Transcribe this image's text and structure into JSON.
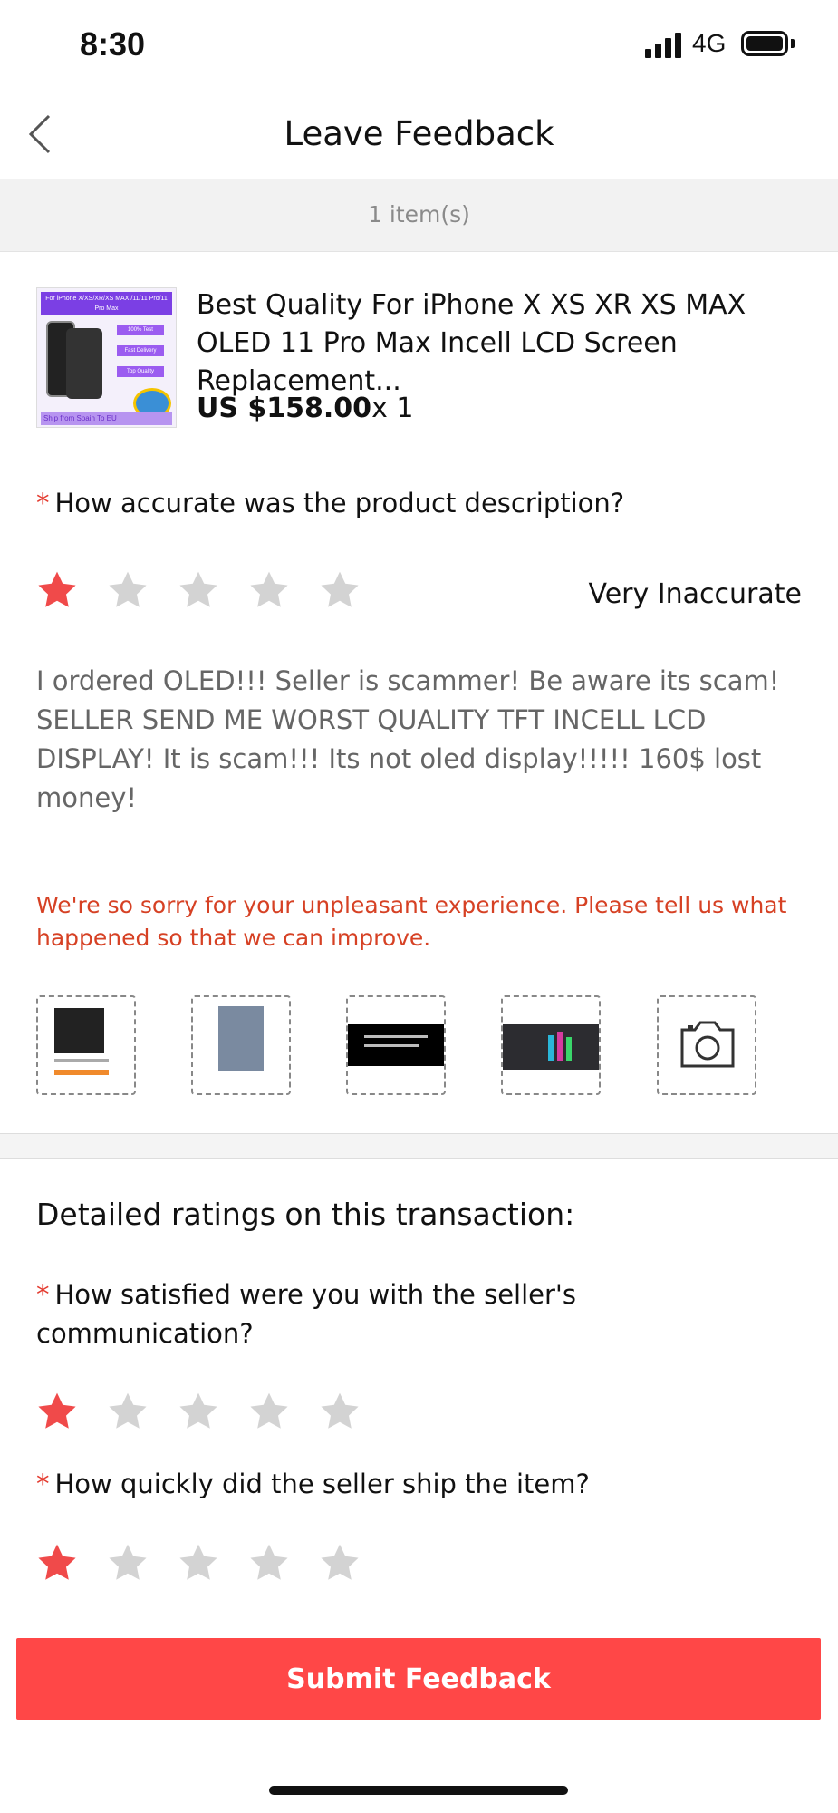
{
  "status_bar": {
    "time": "8:30",
    "network": "4G"
  },
  "nav": {
    "title": "Leave Feedback"
  },
  "items_count": "1 item(s)",
  "product": {
    "title": "Best Quality For iPhone X XS XR XS MAX OLED 11 Pro Max Incell LCD Screen Replacement...",
    "price": "US $158.00",
    "quantity": "x 1",
    "thumb": {
      "title": "For iPhone X/XS/XR/XS MAX /11/11 Pro/11 Pro Max",
      "tags": [
        "100% Test",
        "Fast Delivery",
        "Top Quality"
      ],
      "footer": "Ship from Spain To EU"
    }
  },
  "q1": {
    "required": "*",
    "label": "How accurate was the product description?",
    "rating": 1,
    "max": 5,
    "rating_text": "Very Inaccurate"
  },
  "review_text": "I ordered OLED!!! Seller is scammer! Be aware its scam! SELLER SEND ME WORST QUALITY TFT INCELL LCD DISPLAY! It is scam!!! Its not oled display!!!!!  160$ lost money!",
  "sorry_message": "We're so sorry for your unpleasant experience. Please tell us what happened so that we can improve.",
  "photos": {
    "count": 4,
    "add_icon": "camera-icon"
  },
  "detailed": {
    "heading": "Detailed ratings on this transaction:",
    "q2": {
      "required": "*",
      "label": "How satisfied were you with the seller's communication?",
      "rating": 1,
      "max": 5
    },
    "q3": {
      "required": "*",
      "label": "How quickly did the seller ship the item?",
      "rating": 1,
      "max": 5
    }
  },
  "submit_label": "Submit Feedback",
  "colors": {
    "accent": "#ff4747",
    "star_on": "#f04a4a",
    "star_off": "#d3d3d3",
    "sorry": "#d64124"
  }
}
